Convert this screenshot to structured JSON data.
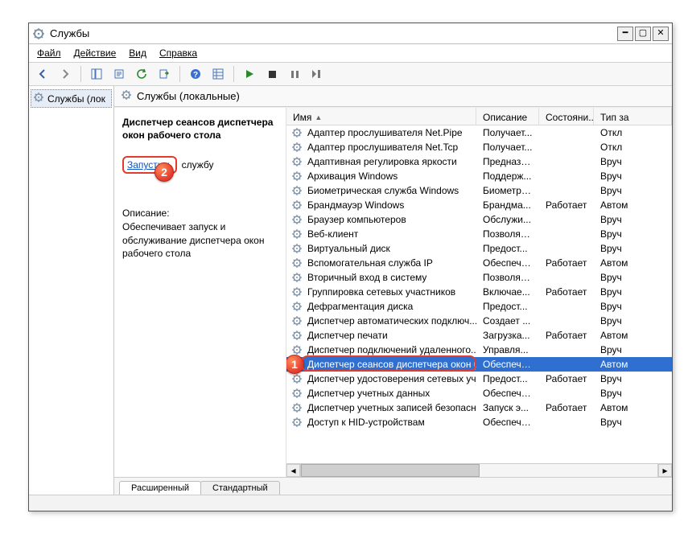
{
  "title": "Службы",
  "menu": {
    "file": "Файл",
    "action": "Действие",
    "view": "Вид",
    "help": "Справка"
  },
  "tree": {
    "node": "Службы (лок"
  },
  "panel_header": "Службы (локальные)",
  "detail": {
    "title": "Диспетчер сеансов диспетчера окон рабочего стола",
    "start_label": "Запустить",
    "start_suffix": " службу",
    "desc_label": "Описание:",
    "desc": "Обеспечивает запуск и обслуживание диспетчера окон рабочего стола"
  },
  "columns": {
    "name": "Имя",
    "desc": "Описание",
    "state": "Состояни...",
    "type": "Тип за"
  },
  "services": [
    {
      "name": "Адаптер прослушивателя Net.Pipe",
      "desc": "Получает...",
      "state": "",
      "type": "Откл"
    },
    {
      "name": "Адаптер прослушивателя Net.Tcp",
      "desc": "Получает...",
      "state": "",
      "type": "Откл"
    },
    {
      "name": "Адаптивная регулировка яркости",
      "desc": "Предназн...",
      "state": "",
      "type": "Вруч"
    },
    {
      "name": "Архивация Windows",
      "desc": "Поддерж...",
      "state": "",
      "type": "Вруч"
    },
    {
      "name": "Биометрическая служба Windows",
      "desc": "Биометри...",
      "state": "",
      "type": "Вруч"
    },
    {
      "name": "Брандмауэр Windows",
      "desc": "Брандма...",
      "state": "Работает",
      "type": "Автом"
    },
    {
      "name": "Браузер компьютеров",
      "desc": "Обслужи...",
      "state": "",
      "type": "Вруч"
    },
    {
      "name": "Веб-клиент",
      "desc": "Позволяе...",
      "state": "",
      "type": "Вруч"
    },
    {
      "name": "Виртуальный диск",
      "desc": "Предост...",
      "state": "",
      "type": "Вруч"
    },
    {
      "name": "Вспомогательная служба IP",
      "desc": "Обеспечи...",
      "state": "Работает",
      "type": "Автом"
    },
    {
      "name": "Вторичный вход в систему",
      "desc": "Позволяе...",
      "state": "",
      "type": "Вруч"
    },
    {
      "name": "Группировка сетевых участников",
      "desc": "Включае...",
      "state": "Работает",
      "type": "Вруч"
    },
    {
      "name": "Дефрагментация диска",
      "desc": "Предост...",
      "state": "",
      "type": "Вруч"
    },
    {
      "name": "Диспетчер автоматических подключ...",
      "desc": "Создает ...",
      "state": "",
      "type": "Вруч"
    },
    {
      "name": "Диспетчер печати",
      "desc": "Загрузка...",
      "state": "Работает",
      "type": "Автом"
    },
    {
      "name": "Диспетчер подключений удаленного...",
      "desc": "Управля...",
      "state": "",
      "type": "Вруч"
    },
    {
      "name": "Диспетчер сеансов диспетчера окон р...",
      "desc": "Обеспечи...",
      "state": "",
      "type": "Автом",
      "selected": true
    },
    {
      "name": "Диспетчер удостоверения сетевых уч...",
      "desc": "Предост...",
      "state": "Работает",
      "type": "Вруч"
    },
    {
      "name": "Диспетчер учетных данных",
      "desc": "Обеспечи...",
      "state": "",
      "type": "Вруч"
    },
    {
      "name": "Диспетчер учетных записей безопасн...",
      "desc": "Запуск э...",
      "state": "Работает",
      "type": "Автом"
    },
    {
      "name": "Доступ к HID-устройствам",
      "desc": "Обеспечи...",
      "state": "",
      "type": "Вруч"
    }
  ],
  "tabs": {
    "extended": "Расширенный",
    "standard": "Стандартный"
  },
  "badges": {
    "one": "1",
    "two": "2"
  }
}
